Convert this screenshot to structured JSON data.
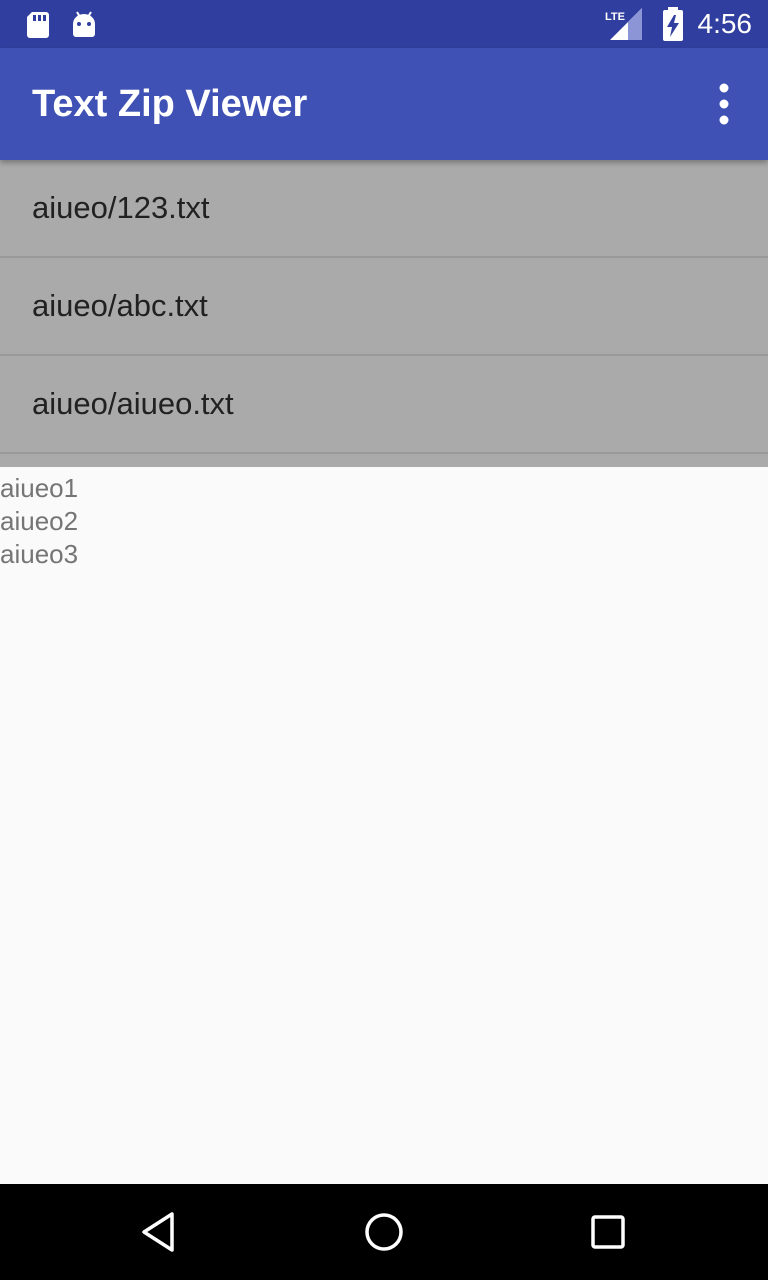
{
  "status_bar": {
    "time": "4:56",
    "network_label": "LTE",
    "icons": [
      "sd-card-icon",
      "android-icon",
      "lte-signal-icon",
      "battery-charging-icon"
    ]
  },
  "app_bar": {
    "title": "Text Zip Viewer",
    "menu_icon": "overflow-menu-icon"
  },
  "file_list": {
    "items": [
      {
        "label": "aiueo/123.txt"
      },
      {
        "label": "aiueo/abc.txt"
      },
      {
        "label": "aiueo/aiueo.txt"
      }
    ]
  },
  "content": {
    "lines": [
      "aiueo1",
      "aiueo2",
      "aiueo3"
    ]
  },
  "nav_bar": {
    "buttons": [
      "back-icon",
      "home-icon",
      "recents-icon"
    ]
  },
  "colors": {
    "status_bar": "#303f9f",
    "app_bar": "#3f51b5",
    "list_background": "#aaaaaa",
    "content_background": "#fafafa",
    "content_text": "#757575"
  }
}
